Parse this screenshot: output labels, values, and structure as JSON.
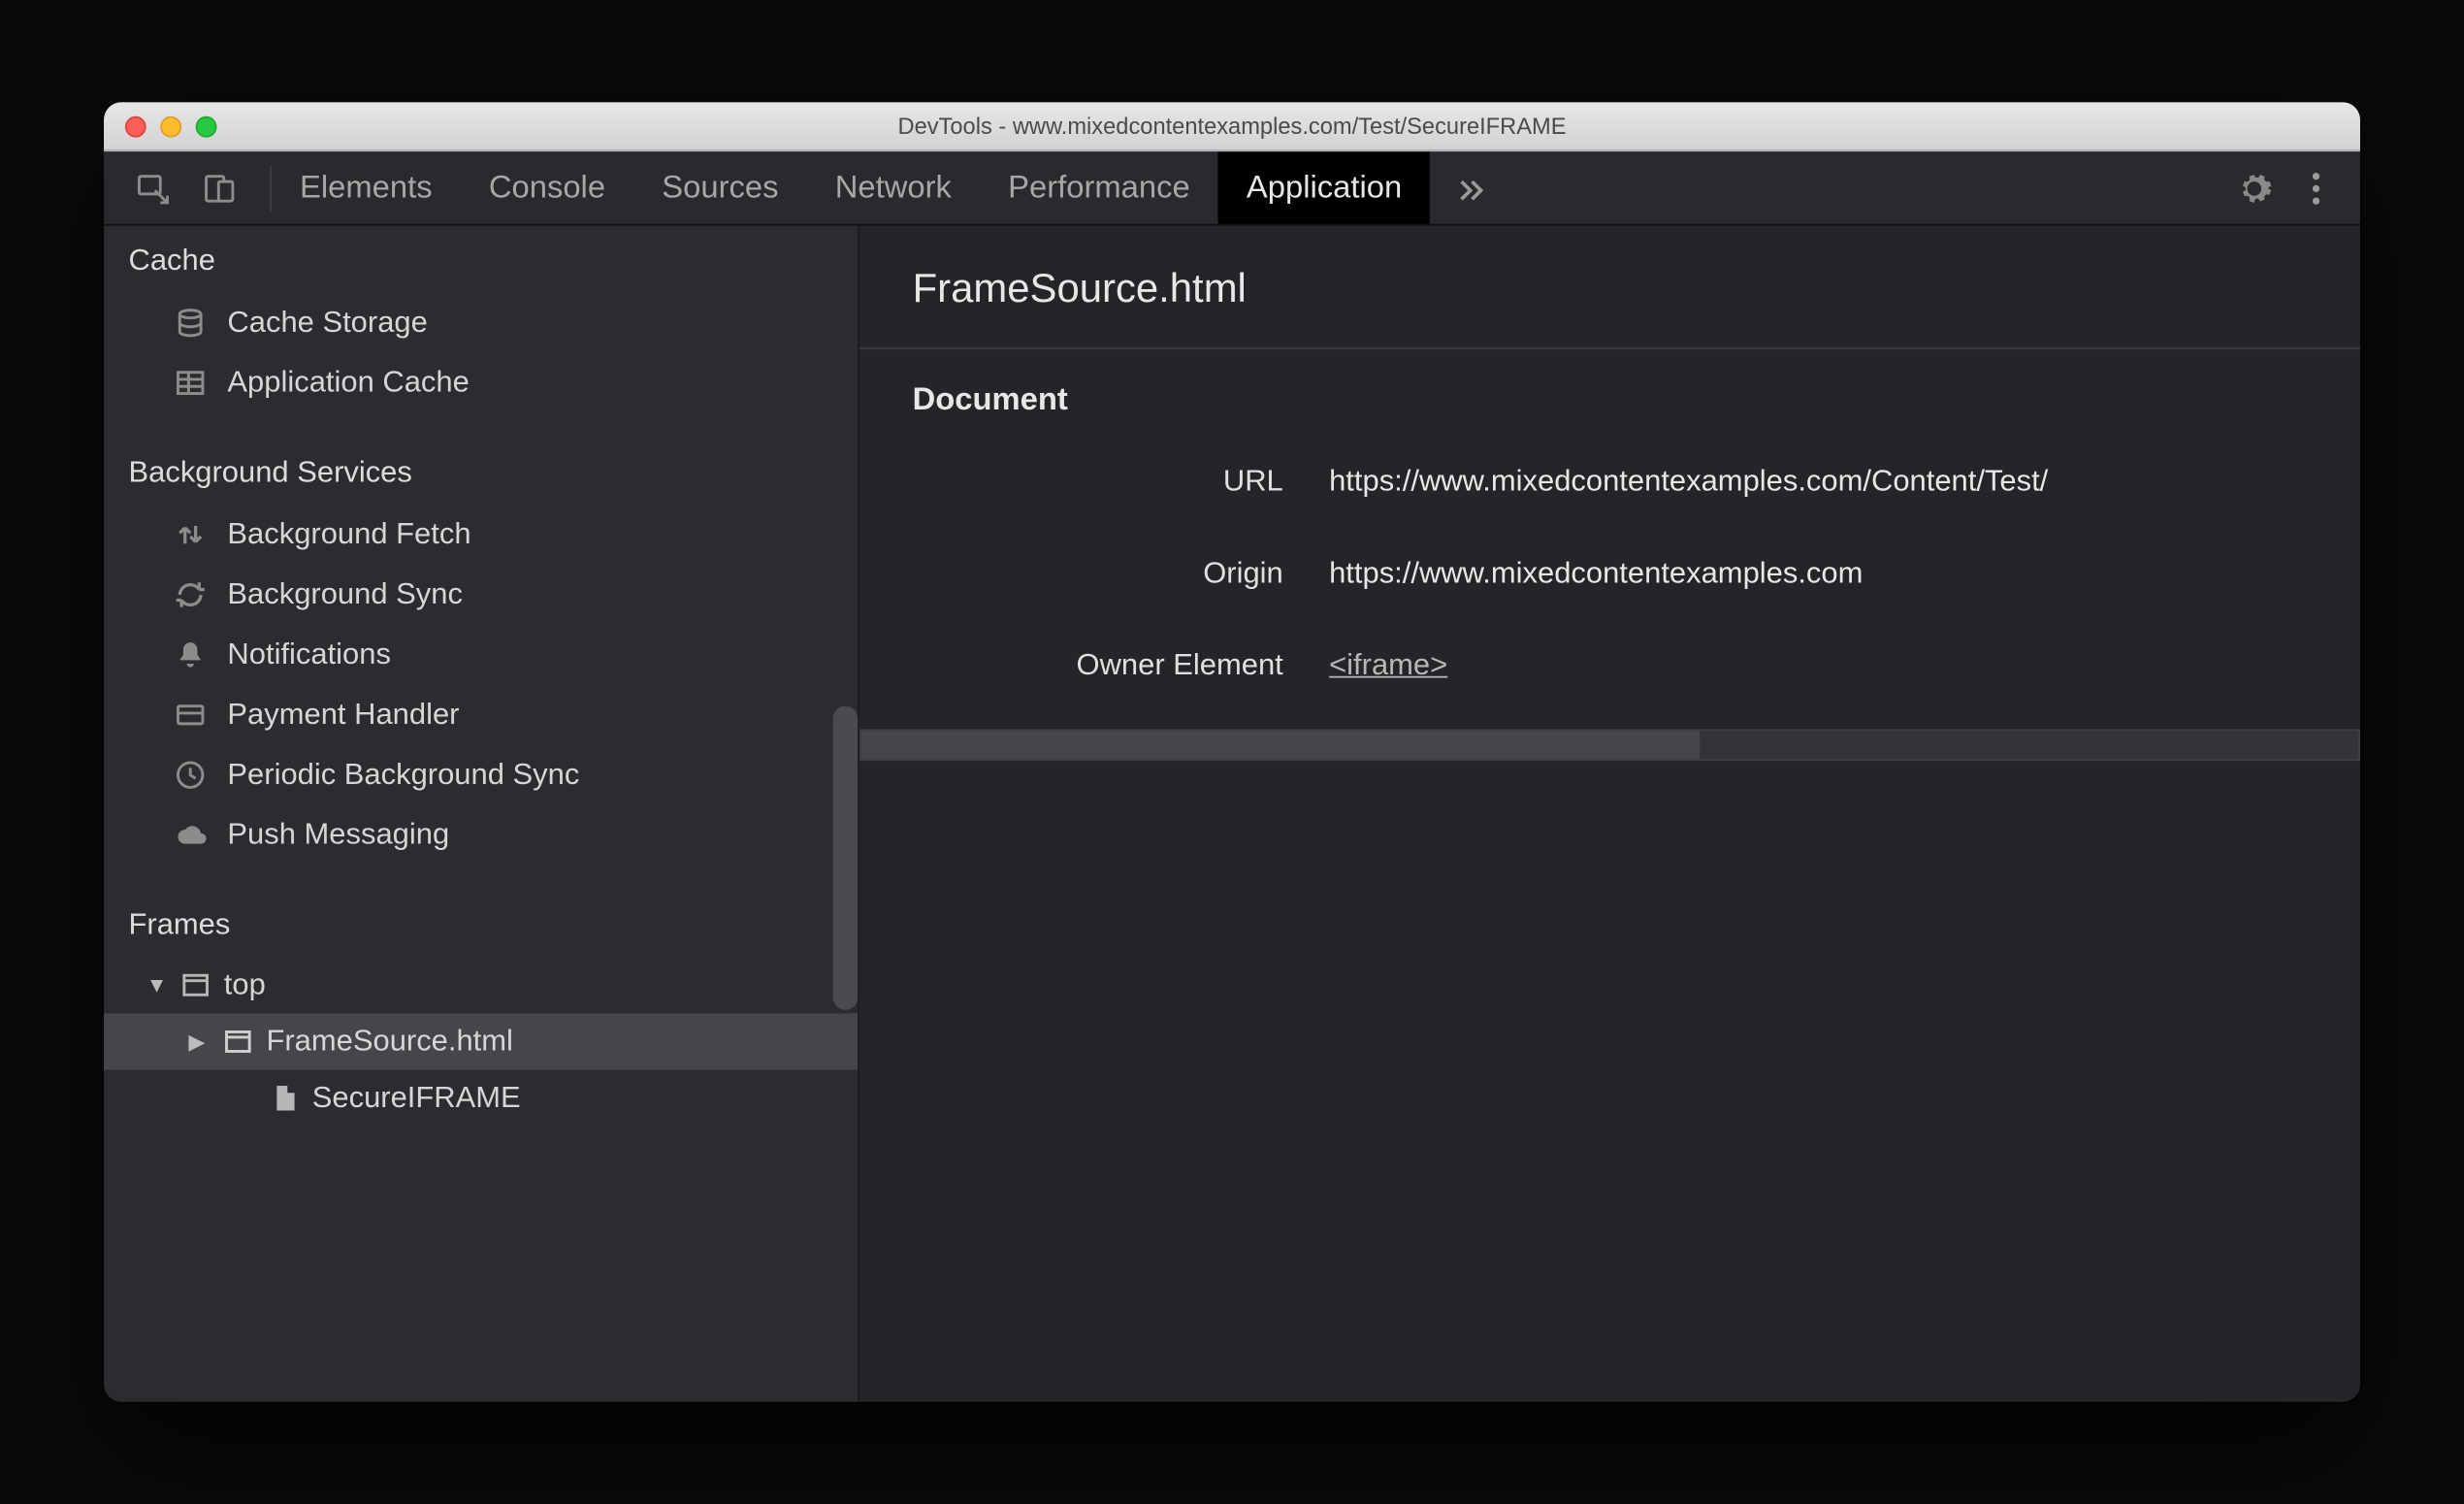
{
  "window": {
    "title": "DevTools - www.mixedcontentexamples.com/Test/SecureIFRAME"
  },
  "tabs": {
    "items": [
      "Elements",
      "Console",
      "Sources",
      "Network",
      "Performance",
      "Application"
    ],
    "active": "Application"
  },
  "sidebar": {
    "cache": {
      "heading": "Cache",
      "items": [
        {
          "icon": "database",
          "label": "Cache Storage"
        },
        {
          "icon": "grid",
          "label": "Application Cache"
        }
      ]
    },
    "bg": {
      "heading": "Background Services",
      "items": [
        {
          "icon": "fetch",
          "label": "Background Fetch"
        },
        {
          "icon": "sync",
          "label": "Background Sync"
        },
        {
          "icon": "bell",
          "label": "Notifications"
        },
        {
          "icon": "card",
          "label": "Payment Handler"
        },
        {
          "icon": "clock",
          "label": "Periodic Background Sync"
        },
        {
          "icon": "cloud",
          "label": "Push Messaging"
        }
      ]
    },
    "frames": {
      "heading": "Frames",
      "tree": {
        "top": "top",
        "child": "FrameSource.html",
        "leaf": "SecureIFRAME"
      }
    }
  },
  "main": {
    "title": "FrameSource.html",
    "section": "Document",
    "url_label": "URL",
    "url_value": "https://www.mixedcontentexamples.com/Content/Test/",
    "origin_label": "Origin",
    "origin_value": "https://www.mixedcontentexamples.com",
    "owner_label": "Owner Element",
    "owner_value": "<iframe>"
  }
}
